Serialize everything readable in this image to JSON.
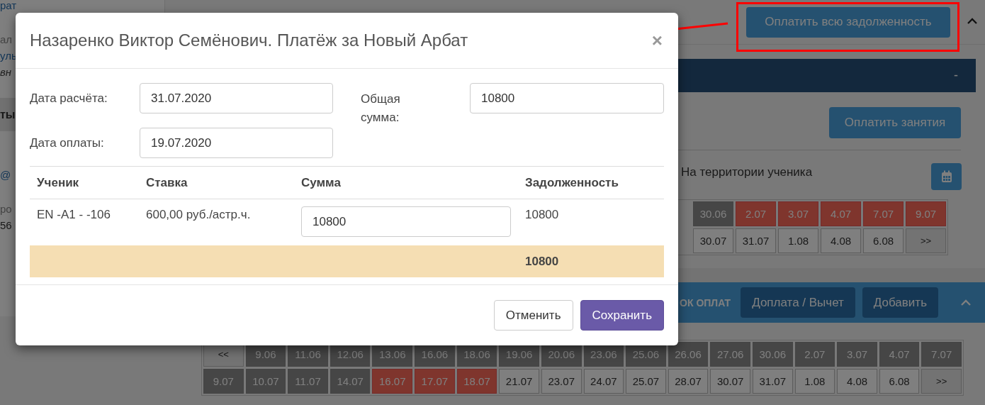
{
  "sidebar": {
    "groups": [
      {
        "items": [
          {
            "text": "рат",
            "kind": "link"
          }
        ]
      },
      {
        "items": [
          {
            "text": "ал",
            "kind": "muted"
          },
          {
            "text": "уль",
            "kind": "link"
          },
          {
            "text": "вн",
            "kind": "italic"
          }
        ]
      },
      {
        "items": [
          {
            "text": "ты",
            "kind": "heading"
          }
        ]
      },
      {
        "items": [
          {
            "text": "@",
            "kind": "link"
          }
        ]
      },
      {
        "items": [
          {
            "text": "ро",
            "kind": "muted"
          },
          {
            "text": "56",
            "kind": "plain"
          }
        ]
      }
    ]
  },
  "header": {
    "pay_all_button": "Оплатить всю задолженность"
  },
  "info_bar": {
    "value": "-"
  },
  "lessons": {
    "pay_button": "Оплатить занятия",
    "location": "На территории ученика",
    "dates": [
      [
        {
          "label": "30.06",
          "kind": "past"
        },
        {
          "label": "2.07",
          "kind": "debt"
        },
        {
          "label": "3.07",
          "kind": "debt"
        },
        {
          "label": "4.07",
          "kind": "debt"
        },
        {
          "label": "7.07",
          "kind": "debt"
        },
        {
          "label": "9.07",
          "kind": "debt"
        }
      ],
      [
        {
          "label": "30.07",
          "kind": "future"
        },
        {
          "label": "31.07",
          "kind": "future"
        },
        {
          "label": "1.08",
          "kind": "future"
        },
        {
          "label": "4.08",
          "kind": "future"
        },
        {
          "label": "6.08",
          "kind": "future"
        },
        {
          "label": ">>",
          "kind": "nav"
        }
      ]
    ]
  },
  "payments_bar": {
    "title": "ОК ОПЛАТ",
    "buttons": [
      "Доплата / Вычет",
      "Добавить"
    ]
  },
  "payment_dates": [
    [
      {
        "label": "<<",
        "kind": "nav"
      },
      {
        "label": "9.06",
        "kind": "past"
      },
      {
        "label": "11.06",
        "kind": "past"
      },
      {
        "label": "12.06",
        "kind": "past"
      },
      {
        "label": "13.06",
        "kind": "past"
      },
      {
        "label": "16.06",
        "kind": "past"
      },
      {
        "label": "18.06",
        "kind": "past"
      },
      {
        "label": "19.06",
        "kind": "past"
      },
      {
        "label": "20.06",
        "kind": "past"
      },
      {
        "label": "23.06",
        "kind": "past"
      },
      {
        "label": "25.06",
        "kind": "past"
      },
      {
        "label": "26.06",
        "kind": "past"
      },
      {
        "label": "27.06",
        "kind": "past"
      },
      {
        "label": "30.06",
        "kind": "past"
      },
      {
        "label": "2.07",
        "kind": "past"
      },
      {
        "label": "3.07",
        "kind": "past"
      },
      {
        "label": "4.07",
        "kind": "past"
      },
      {
        "label": "7.07",
        "kind": "past"
      }
    ],
    [
      {
        "label": "9.07",
        "kind": "past"
      },
      {
        "label": "10.07",
        "kind": "past"
      },
      {
        "label": "11.07",
        "kind": "past"
      },
      {
        "label": "14.07",
        "kind": "past"
      },
      {
        "label": "16.07",
        "kind": "debt"
      },
      {
        "label": "17.07",
        "kind": "debt"
      },
      {
        "label": "18.07",
        "kind": "debt"
      },
      {
        "label": "21.07",
        "kind": "future"
      },
      {
        "label": "23.07",
        "kind": "future"
      },
      {
        "label": "24.07",
        "kind": "future"
      },
      {
        "label": "25.07",
        "kind": "future"
      },
      {
        "label": "28.07",
        "kind": "future"
      },
      {
        "label": "30.07",
        "kind": "future"
      },
      {
        "label": "31.07",
        "kind": "future"
      },
      {
        "label": "1.08",
        "kind": "future"
      },
      {
        "label": "4.08",
        "kind": "future"
      },
      {
        "label": "6.08",
        "kind": "future"
      },
      {
        "label": ">>",
        "kind": "nav"
      }
    ]
  ],
  "dialog": {
    "title": "Назаренко Виктор Семёнович. Платёж за Новый Арбат",
    "close": "×",
    "fields": [
      {
        "label": "Дата расчёта:",
        "value": "31.07.2020"
      },
      {
        "label": "Дата оплаты:",
        "value": "19.07.2020"
      }
    ],
    "total": {
      "label": "Общая сумма:",
      "value": "10800"
    },
    "table": {
      "columns": [
        "Ученик",
        "Ставка",
        "Сумма",
        "Задолженность"
      ],
      "rows": [
        {
          "student": "EN -A1 - -106",
          "rate": "600,00 руб./астр.ч.",
          "amount": "10800",
          "debt": "10800"
        }
      ],
      "footer_total": "10800"
    },
    "buttons": [
      {
        "label": "Отменить",
        "kind": "secondary"
      },
      {
        "label": "Сохранить",
        "kind": "primary"
      }
    ]
  }
}
